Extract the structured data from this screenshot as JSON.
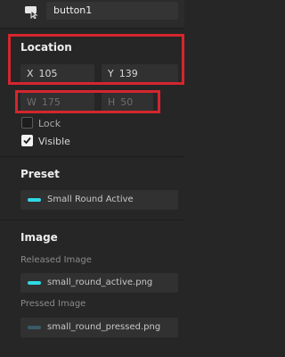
{
  "colors": {
    "background": "#262626",
    "field": "#313131",
    "highlight_box": "#d4262e",
    "swatch_active": "#2fd9e4",
    "swatch_pressed": "#3a5b66"
  },
  "header": {
    "icon": "button-widget-icon",
    "name_value": "button1"
  },
  "location": {
    "title": "Location",
    "x_label": "X",
    "x_value": "105",
    "y_label": "Y",
    "y_value": "139"
  },
  "size": {
    "w_label": "W",
    "w_value": "175",
    "h_label": "H",
    "h_value": "50"
  },
  "options": {
    "lock_label": "Lock",
    "lock_checked": false,
    "visible_label": "Visible",
    "visible_checked": true
  },
  "preset": {
    "title": "Preset",
    "value": "Small Round Active"
  },
  "image": {
    "title": "Image",
    "released_label": "Released Image",
    "released_value": "small_round_active.png",
    "pressed_label": "Pressed Image",
    "pressed_value": "small_round_pressed.png"
  }
}
